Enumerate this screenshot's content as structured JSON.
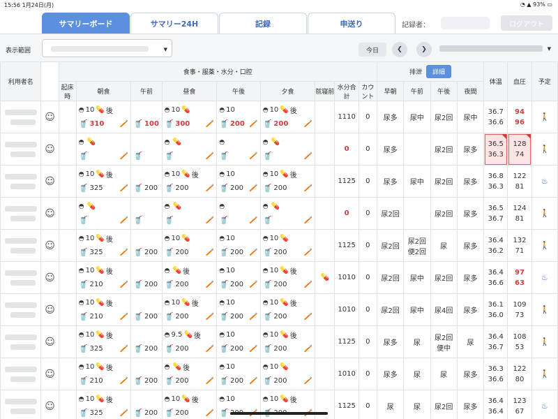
{
  "status": {
    "time_date": "15:56  1月24日(月)",
    "battery": "93%"
  },
  "tabs": [
    {
      "label": "サマリーボード",
      "active": true
    },
    {
      "label": "サマリー24H",
      "active": false
    },
    {
      "label": "記録",
      "active": false
    },
    {
      "label": "申送り",
      "active": false
    }
  ],
  "header": {
    "recorder_label": "記録者：",
    "logout_label": "ログアウト"
  },
  "range": {
    "label": "表示範囲",
    "today_label": "今日"
  },
  "table": {
    "head": {
      "name": "利用者名",
      "meal_group": "食事・服薬・水分・口腔",
      "excretion_group": "排泄",
      "detail_button": "詳細",
      "temp": "体温",
      "bp": "血圧",
      "plan": "予定",
      "wake": "起床時",
      "breakfast": "朝食",
      "am": "午前",
      "lunch": "昼食",
      "pm": "午後",
      "dinner": "夕食",
      "bedtime": "就寝前",
      "water_total": "水分合計",
      "count": "カウント",
      "early": "早朝",
      "ex_am": "午前",
      "ex_pm": "午後",
      "night": "夜間"
    },
    "rows": [
      {
        "bf_top": "10",
        "bf_pill": "後",
        "bf_drink": "310",
        "bf_red": true,
        "am_drink": "100",
        "am_red": true,
        "lu_top": "10",
        "lu_pill": "",
        "lu_drink": "300",
        "lu_red": true,
        "pm_top": "10",
        "pm_drink": "200",
        "pm_red": true,
        "di_top": "10",
        "di_pill": "後",
        "di_drink": "200",
        "di_red": true,
        "bed": "",
        "total": "1110",
        "total_red": false,
        "count": "0",
        "early": "尿多",
        "ex_am": "尿中",
        "ex_pm": "尿2回",
        "night": "尿中",
        "temp1": "36.7",
        "temp2": "36.6",
        "bp1": "94",
        "bp2": "96",
        "bp_red": true,
        "alert": false,
        "plan": "walker-icon"
      },
      {
        "bf_top": "",
        "bf_pill": "",
        "bf_drink": "",
        "bf_red": false,
        "am_drink": "",
        "am_red": false,
        "lu_top": "",
        "lu_pill": "",
        "lu_drink": "",
        "lu_red": false,
        "pm_top": "",
        "pm_drink": "",
        "pm_red": false,
        "di_top": "",
        "di_pill": "",
        "di_drink": "",
        "di_red": false,
        "bed": "",
        "total": "0",
        "total_red": true,
        "count": "0",
        "early": "尿多",
        "ex_am": "",
        "ex_pm": "尿2回",
        "night": "尿多",
        "temp1": "36.5",
        "temp2": "36.3",
        "bp1": "128",
        "bp2": "74",
        "bp_red": false,
        "alert": true,
        "plan": "walker-icon"
      },
      {
        "bf_top": "10",
        "bf_pill": "後",
        "bf_drink": "325",
        "bf_red": false,
        "am_drink": "200",
        "am_red": false,
        "lu_top": "10",
        "lu_pill": "後",
        "lu_drink": "200",
        "lu_red": false,
        "pm_top": "10",
        "pm_drink": "200",
        "pm_red": false,
        "di_top": "10",
        "di_pill": "後",
        "di_drink": "200",
        "di_red": false,
        "bed": "",
        "total": "1125",
        "total_red": false,
        "count": "0",
        "early": "尿多",
        "ex_am": "尿中",
        "ex_pm": "尿2回",
        "night": "尿多",
        "temp1": "36.8",
        "temp2": "36.3",
        "bp1": "122",
        "bp2": "81",
        "bp_red": false,
        "alert": false,
        "plan": "bath-icon"
      },
      {
        "bf_top": "",
        "bf_pill": "",
        "bf_drink": "",
        "bf_red": false,
        "am_drink": "",
        "am_red": false,
        "lu_top": "",
        "lu_pill": "",
        "lu_drink": "",
        "lu_red": false,
        "pm_top": "",
        "pm_drink": "",
        "pm_red": false,
        "di_top": "",
        "di_pill": "",
        "di_drink": "",
        "di_red": false,
        "bed": "",
        "total": "0",
        "total_red": true,
        "count": "0",
        "early": "尿2回",
        "ex_am": "",
        "ex_pm": "尿2回",
        "night": "尿多",
        "temp1": "36.5",
        "temp2": "36.7",
        "bp1": "124",
        "bp2": "81",
        "bp_red": false,
        "alert": false,
        "plan": "walker-icon"
      },
      {
        "bf_top": "10",
        "bf_pill": "後",
        "bf_drink": "325",
        "bf_red": false,
        "am_drink": "200",
        "am_red": false,
        "lu_top": "10",
        "lu_pill": "",
        "lu_drink": "200",
        "lu_red": false,
        "pm_top": "10",
        "pm_drink": "200",
        "pm_red": false,
        "di_top": "10",
        "di_pill": "",
        "di_drink": "200",
        "di_red": false,
        "bed": "",
        "total": "1125",
        "total_red": false,
        "count": "0",
        "early": "尿2回",
        "ex_am": "尿2回 便2回",
        "ex_pm": "尿",
        "night": "尿多",
        "temp1": "36.4",
        "temp2": "36.2",
        "bp1": "132",
        "bp2": "71",
        "bp_red": false,
        "alert": false,
        "plan": "walker-icon"
      },
      {
        "bf_top": "10",
        "bf_pill": "後",
        "bf_drink": "210",
        "bf_red": false,
        "am_drink": "200",
        "am_red": false,
        "lu_top": "",
        "lu_pill": "後",
        "lu_drink": "200",
        "lu_red": false,
        "pm_top": "10",
        "pm_drink": "200",
        "pm_red": false,
        "di_top": "10",
        "di_pill": "後",
        "di_drink": "200",
        "di_red": false,
        "bed": "pill",
        "total": "1010",
        "total_red": false,
        "count": "0",
        "early": "尿2回",
        "ex_am": "尿中",
        "ex_pm": "尿2回",
        "night": "尿多",
        "temp1": "36.4",
        "temp2": "36.6",
        "bp1": "97",
        "bp2": "63",
        "bp_red": true,
        "alert": false,
        "plan": "bath-icon"
      },
      {
        "bf_top": "10",
        "bf_pill": "後",
        "bf_drink": "210",
        "bf_red": false,
        "am_drink": "200",
        "am_red": false,
        "lu_top": "10",
        "lu_pill": "後",
        "lu_drink": "200",
        "lu_red": false,
        "pm_top": "10",
        "pm_drink": "200",
        "pm_red": false,
        "di_top": "10",
        "di_pill": "後",
        "di_drink": "200",
        "di_red": false,
        "bed": "",
        "total": "1010",
        "total_red": false,
        "count": "0",
        "early": "尿2回",
        "ex_am": "尿中",
        "ex_pm": "尿4回",
        "night": "尿多",
        "temp1": "36.1",
        "temp2": "36.0",
        "bp1": "109",
        "bp2": "73",
        "bp_red": false,
        "alert": false,
        "plan": "walker-icon"
      },
      {
        "bf_top": "10",
        "bf_pill": "後",
        "bf_drink": "325",
        "bf_red": false,
        "am_drink": "200",
        "am_red": false,
        "lu_top": "9.5",
        "lu_pill": "後",
        "lu_drink": "200",
        "lu_red": false,
        "pm_top": "10",
        "pm_drink": "200",
        "pm_red": false,
        "di_top": "10",
        "di_pill": "後",
        "di_drink": "200",
        "di_red": false,
        "bed": "",
        "total": "1125",
        "total_red": false,
        "count": "0",
        "early": "尿多",
        "ex_am": "尿",
        "ex_pm": "尿2回 便中",
        "night": "尿",
        "temp1": "36.4",
        "temp2": "36.7",
        "bp1": "108",
        "bp2": "53",
        "bp_red": false,
        "alert": false,
        "plan": "walker-icon"
      },
      {
        "bf_top": "10",
        "bf_pill": "後",
        "bf_drink": "210",
        "bf_red": false,
        "am_drink": "200",
        "am_red": false,
        "lu_top": "",
        "lu_pill": "後",
        "lu_drink": "200",
        "lu_red": false,
        "pm_top": "10",
        "pm_drink": "200",
        "pm_red": false,
        "di_top": "10",
        "di_pill": "",
        "di_drink": "200",
        "di_red": false,
        "bed": "",
        "total": "1010",
        "total_red": false,
        "count": "0",
        "early": "尿多",
        "ex_am": "尿",
        "ex_pm": "尿",
        "night": "尿多",
        "temp1": "36.3",
        "temp2": "36.6",
        "bp1": "122",
        "bp2": "80",
        "bp_red": false,
        "alert": false,
        "plan": "walker-icon"
      },
      {
        "bf_top": "10",
        "bf_pill": "後",
        "bf_drink": "325",
        "bf_red": false,
        "am_drink": "200",
        "am_red": false,
        "lu_top": "10",
        "lu_pill": "後",
        "lu_drink": "200",
        "lu_red": false,
        "pm_top": "10",
        "pm_drink": "200",
        "pm_red": false,
        "di_top": "10",
        "di_pill": "後",
        "di_drink": "200",
        "di_red": false,
        "bed": "",
        "total": "1125",
        "total_red": false,
        "count": "0",
        "early": "尿",
        "ex_am": "尿",
        "ex_pm": "尿2回",
        "night": "尿多",
        "temp1": "36.4",
        "temp2": "36.4",
        "bp1": "123",
        "bp2": "67",
        "bp_red": false,
        "alert": false,
        "plan": "bath-icon"
      }
    ]
  },
  "colors": {
    "accent": "#5b8fe0",
    "alert_red": "#d03b3b",
    "header_bg": "#f3f4f6"
  }
}
